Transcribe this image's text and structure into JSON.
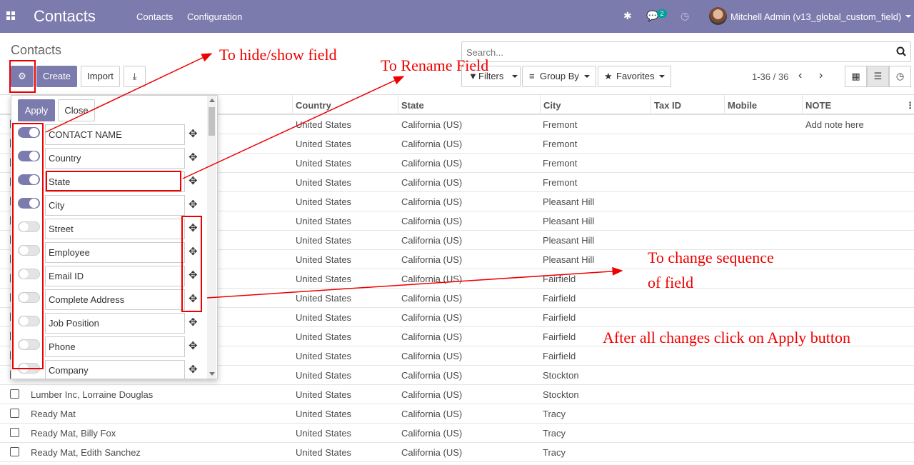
{
  "navbar": {
    "brand": "Contacts",
    "menu": [
      "Contacts",
      "Configuration"
    ],
    "message_count": "2",
    "user": "Mitchell Admin (v13_global_custom_field)"
  },
  "control": {
    "breadcrumb": "Contacts",
    "create": "Create",
    "import": "Import",
    "search_placeholder": "Search...",
    "filters": "Filters",
    "group_by": "Group By",
    "favorites": "Favorites",
    "pager": "1-36 / 36"
  },
  "columns": [
    "Country",
    "State",
    "City",
    "Tax ID",
    "Mobile",
    "NOTE"
  ],
  "rows": [
    {
      "name": "",
      "country": "United States",
      "state": "California (US)",
      "city": "Fremont",
      "note": "Add note here"
    },
    {
      "name": "",
      "country": "United States",
      "state": "California (US)",
      "city": "Fremont",
      "note": ""
    },
    {
      "name": "",
      "country": "United States",
      "state": "California (US)",
      "city": "Fremont",
      "note": ""
    },
    {
      "name": "",
      "country": "United States",
      "state": "California (US)",
      "city": "Fremont",
      "note": ""
    },
    {
      "name": "",
      "country": "United States",
      "state": "California (US)",
      "city": "Pleasant Hill",
      "note": ""
    },
    {
      "name": "",
      "country": "United States",
      "state": "California (US)",
      "city": "Pleasant Hill",
      "note": ""
    },
    {
      "name": "",
      "country": "United States",
      "state": "California (US)",
      "city": "Pleasant Hill",
      "note": ""
    },
    {
      "name": "",
      "country": "United States",
      "state": "California (US)",
      "city": "Pleasant Hill",
      "note": ""
    },
    {
      "name": "",
      "country": "United States",
      "state": "California (US)",
      "city": "Fairfield",
      "note": ""
    },
    {
      "name": "",
      "country": "United States",
      "state": "California (US)",
      "city": "Fairfield",
      "note": ""
    },
    {
      "name": "",
      "country": "United States",
      "state": "California (US)",
      "city": "Fairfield",
      "note": ""
    },
    {
      "name": "",
      "country": "United States",
      "state": "California (US)",
      "city": "Fairfield",
      "note": ""
    },
    {
      "name": "",
      "country": "United States",
      "state": "California (US)",
      "city": "Fairfield",
      "note": ""
    },
    {
      "name": "",
      "country": "United States",
      "state": "California (US)",
      "city": "Stockton",
      "note": ""
    },
    {
      "name": "Lumber Inc, Lorraine Douglas",
      "country": "United States",
      "state": "California (US)",
      "city": "Stockton",
      "note": ""
    },
    {
      "name": "Ready Mat",
      "country": "United States",
      "state": "California (US)",
      "city": "Tracy",
      "note": ""
    },
    {
      "name": "Ready Mat, Billy Fox",
      "country": "United States",
      "state": "California (US)",
      "city": "Tracy",
      "note": ""
    },
    {
      "name": "Ready Mat, Edith Sanchez",
      "country": "United States",
      "state": "California (US)",
      "city": "Tracy",
      "note": ""
    }
  ],
  "field_popup": {
    "apply": "Apply",
    "close": "Close",
    "fields": [
      {
        "label": "CONTACT NAME",
        "visible": true
      },
      {
        "label": "Country",
        "visible": true
      },
      {
        "label": "State",
        "visible": true
      },
      {
        "label": "City",
        "visible": true
      },
      {
        "label": "Street",
        "visible": false
      },
      {
        "label": "Employee",
        "visible": false
      },
      {
        "label": "Email ID",
        "visible": false
      },
      {
        "label": "Complete Address",
        "visible": false
      },
      {
        "label": "Job Position",
        "visible": false
      },
      {
        "label": "Phone",
        "visible": false
      },
      {
        "label": "Company",
        "visible": false
      }
    ]
  },
  "annotations": {
    "hide_show": "To hide/show field",
    "rename": "To Rename Field",
    "sequence_line1": "To change sequence",
    "sequence_line2": "of field",
    "apply_note": "After all changes click on Apply button"
  },
  "colors": {
    "navbar": "#7c7bad",
    "accent": "#7c7bad",
    "annotation": "#e00000"
  }
}
